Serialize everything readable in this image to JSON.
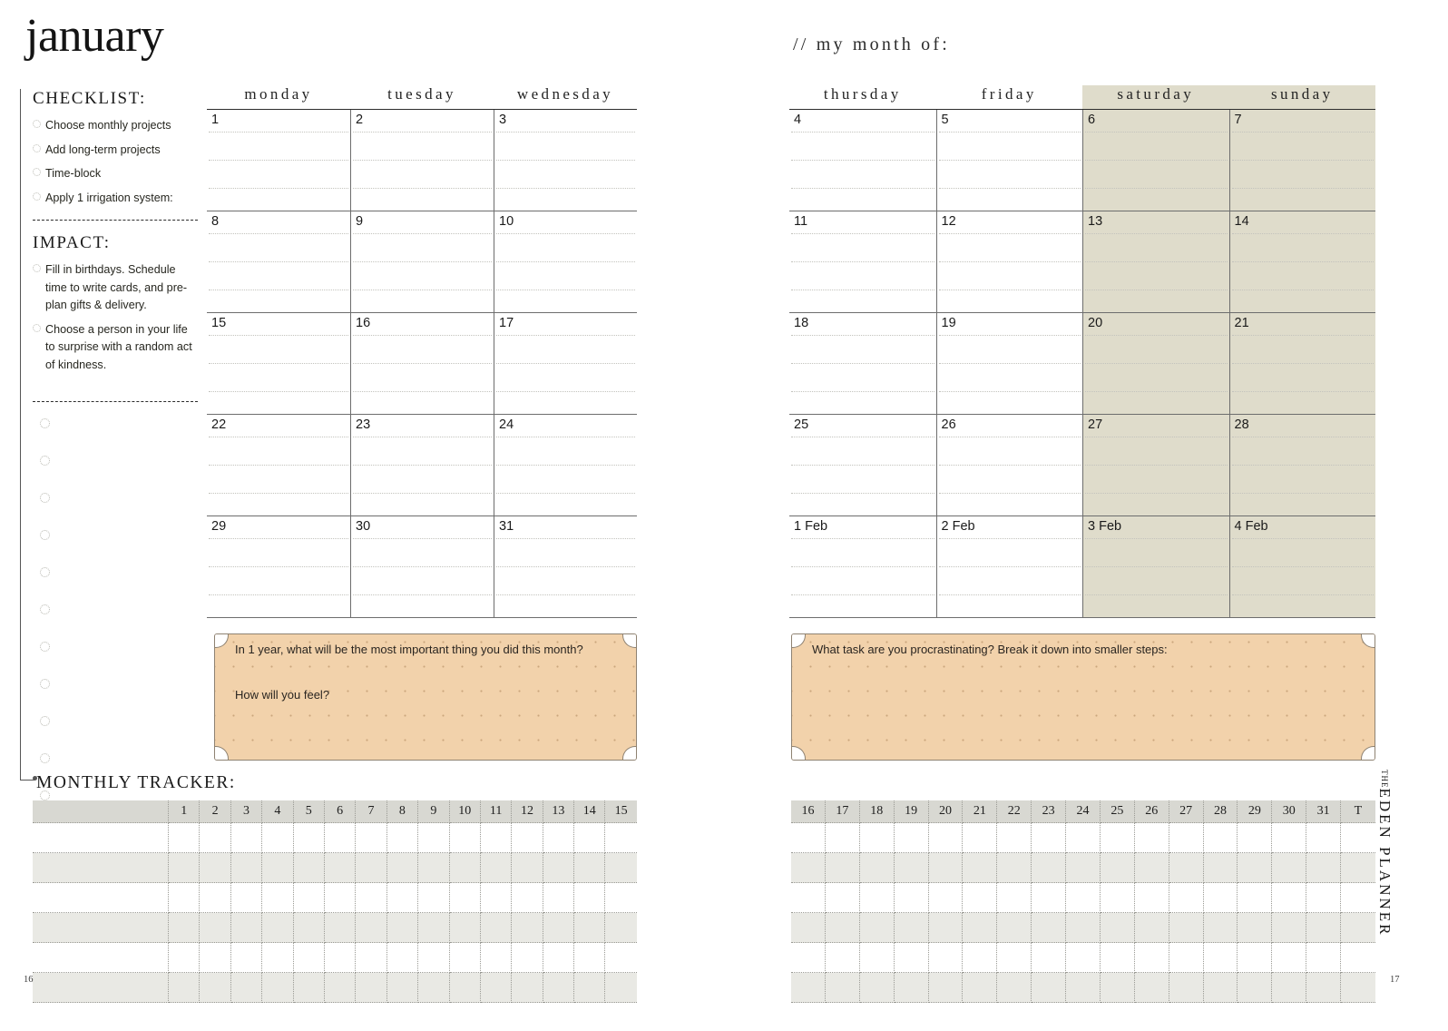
{
  "month_title": "january",
  "my_month_label": "// my month of:",
  "brand": {
    "the": "THE",
    "name": "EDEN PLANNER"
  },
  "page_numbers": {
    "left": "16",
    "right": "17"
  },
  "sidebar": {
    "checklist_heading": "CHECKLIST:",
    "checklist_items": [
      "Choose monthly projects",
      "Add long-term projects",
      "Time-block",
      "Apply 1 irrigation system:"
    ],
    "impact_heading": "IMPACT:",
    "impact_items": [
      "Fill in birthdays. Schedule time to write cards, and pre-plan gifts & delivery.",
      "Choose a person in your life to surprise with a random act of kindness."
    ],
    "blank_circle_count": 11,
    "tracker_heading": "MONTHLY TRACKER:"
  },
  "calendar": {
    "left_days": [
      "monday",
      "tuesday",
      "wednesday"
    ],
    "right_days": [
      "thursday",
      "friday",
      "saturday",
      "sunday"
    ],
    "shaded_days": [
      "saturday",
      "sunday"
    ],
    "shade_color": "#dfdccb",
    "weeks_left": [
      [
        "1",
        "2",
        "3"
      ],
      [
        "8",
        "9",
        "10"
      ],
      [
        "15",
        "16",
        "17"
      ],
      [
        "22",
        "23",
        "24"
      ],
      [
        "29",
        "30",
        "31"
      ]
    ],
    "weeks_right": [
      [
        "4",
        "5",
        "6",
        "7"
      ],
      [
        "11",
        "12",
        "13",
        "14"
      ],
      [
        "18",
        "19",
        "20",
        "21"
      ],
      [
        "25",
        "26",
        "27",
        "28"
      ],
      [
        "1 Feb",
        "2 Feb",
        "3 Feb",
        "4 Feb"
      ]
    ],
    "rules_per_cell": 3
  },
  "prompts": {
    "left": {
      "question_1": "In 1 year, what will be the most important thing you did this month?",
      "question_2": "How will you feel?"
    },
    "right": {
      "question_1": "What task are you procrastinating? Break it down into smaller steps:"
    },
    "fill_color": "#f2d2ab"
  },
  "tracker": {
    "left_columns": [
      "1",
      "2",
      "3",
      "4",
      "5",
      "6",
      "7",
      "8",
      "9",
      "10",
      "11",
      "12",
      "13",
      "14",
      "15"
    ],
    "right_columns": [
      "16",
      "17",
      "18",
      "19",
      "20",
      "21",
      "22",
      "23",
      "24",
      "25",
      "26",
      "27",
      "28",
      "29",
      "30",
      "31",
      "T"
    ],
    "row_count": 6,
    "header_color": "#d8d8d2",
    "alt_row_color": "#e9e9e4"
  }
}
